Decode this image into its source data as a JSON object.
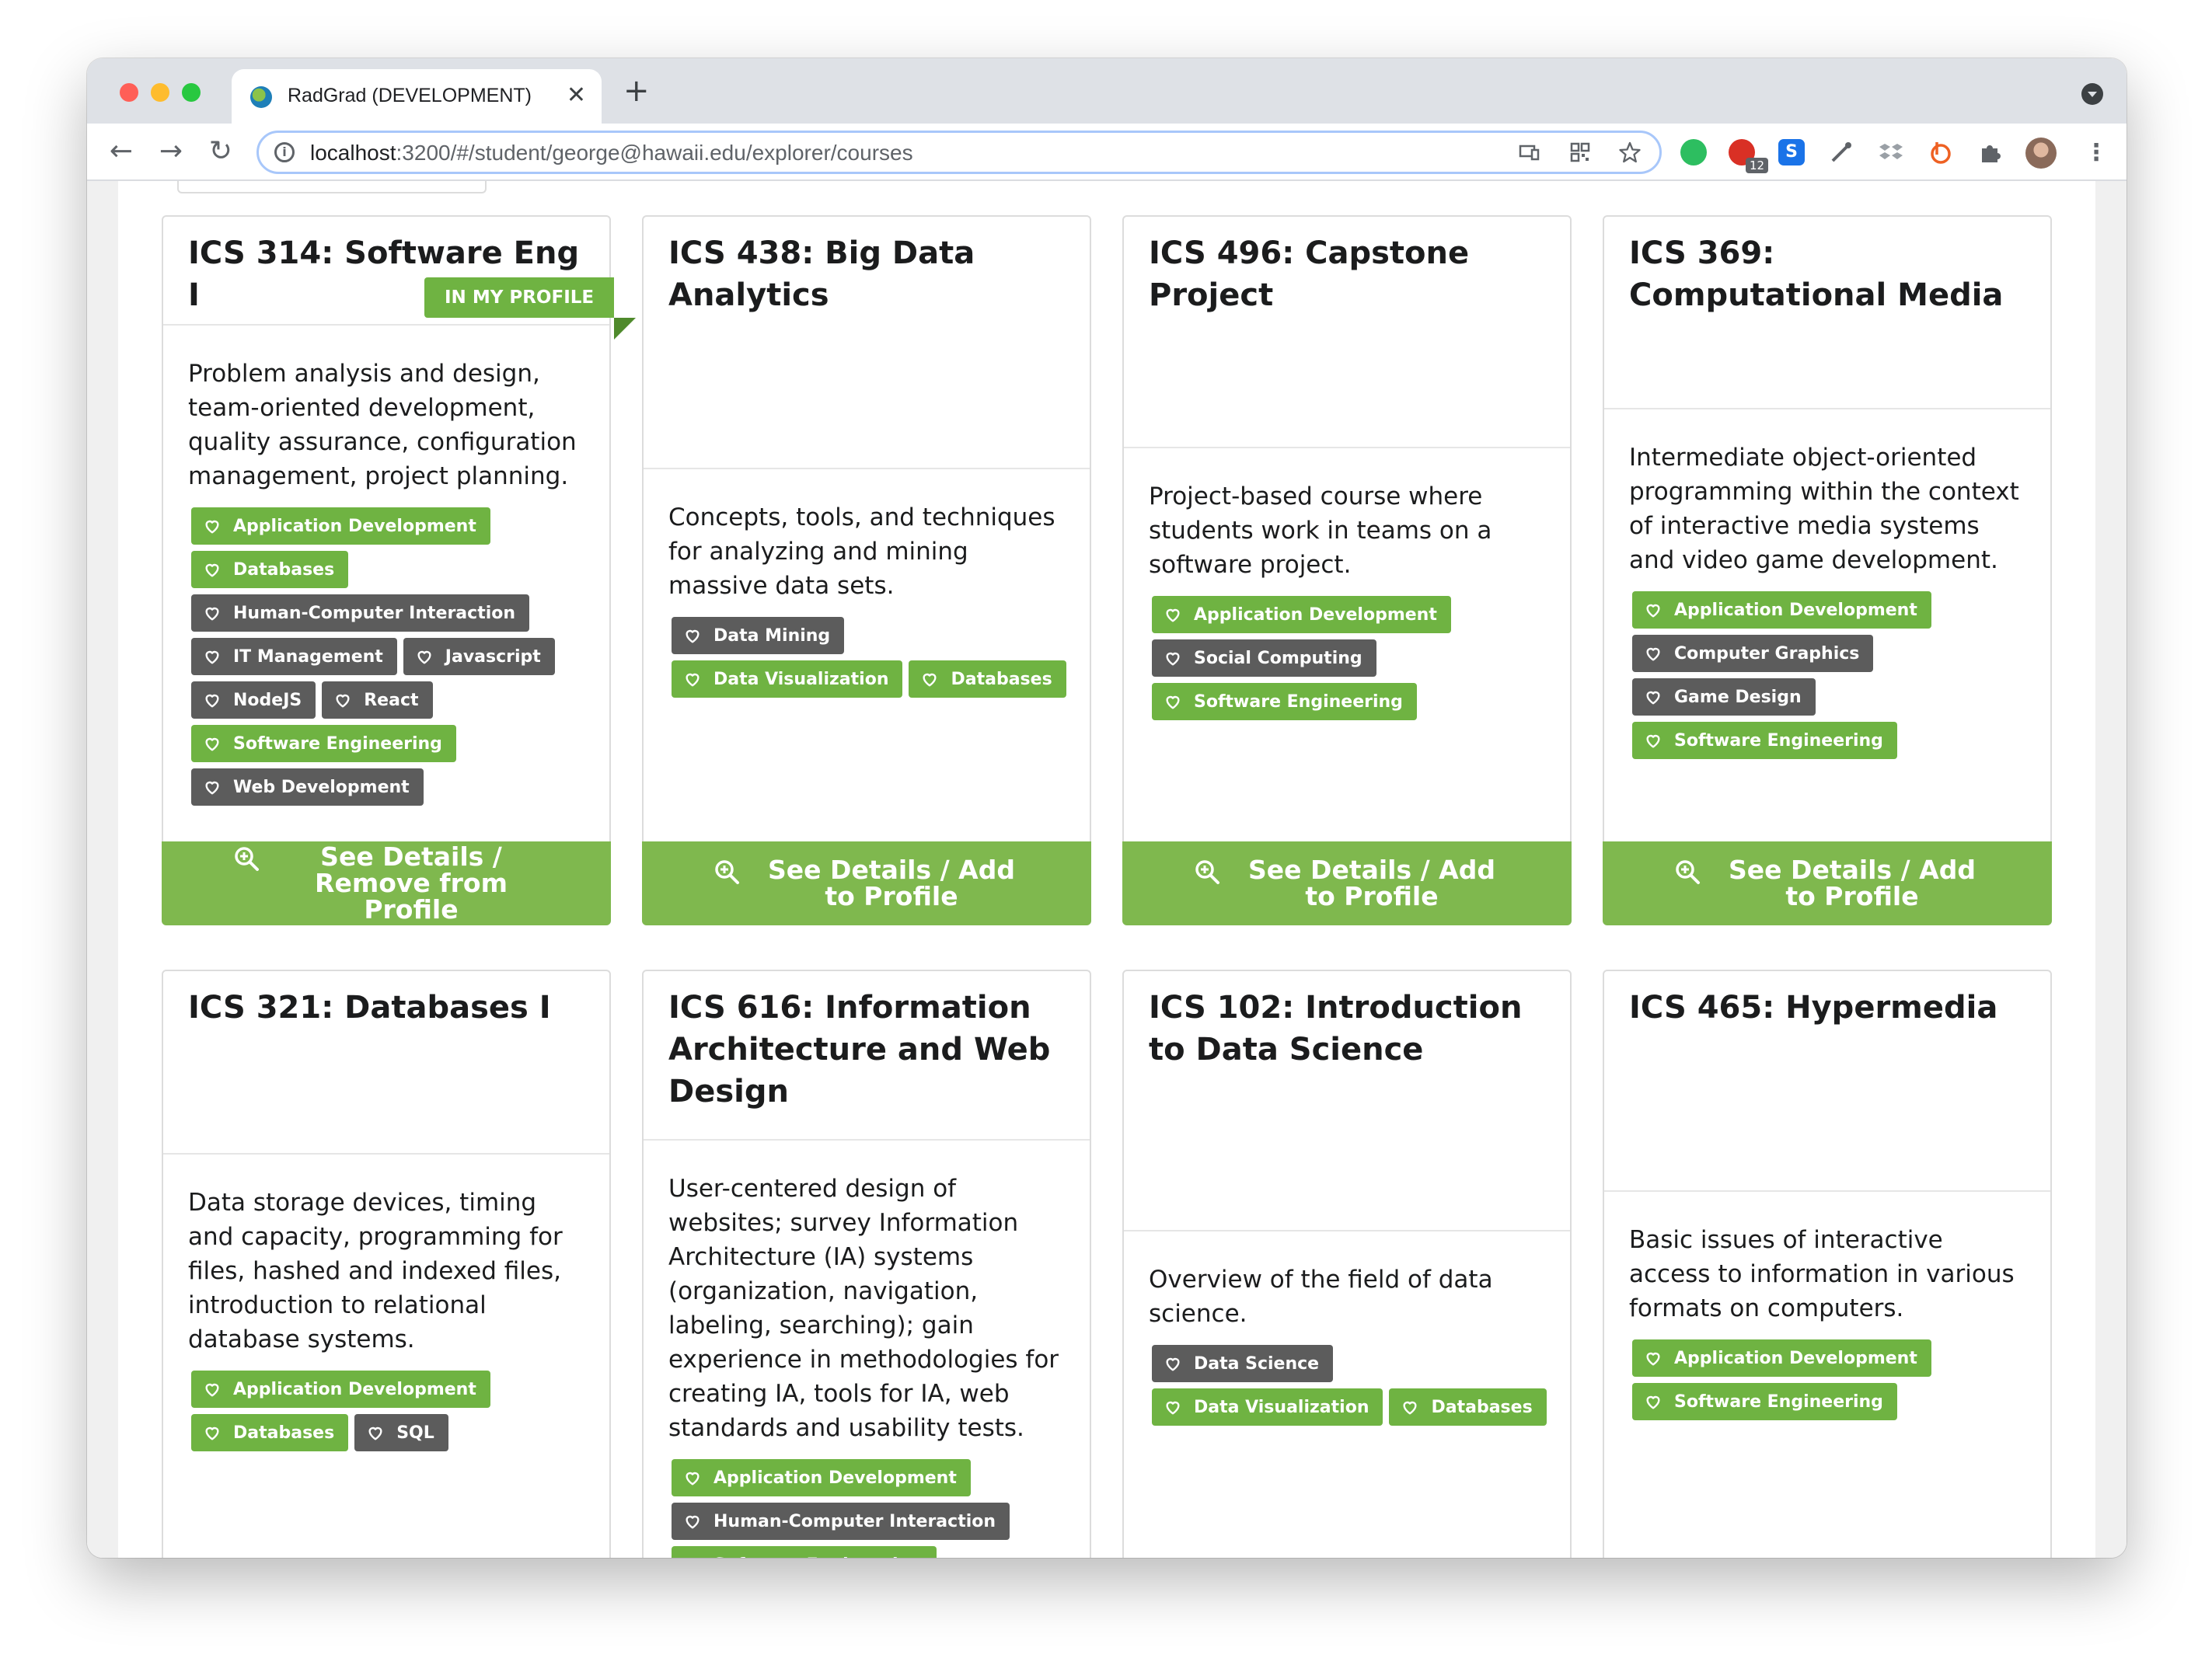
{
  "browser": {
    "tab_title": "RadGrad (DEVELOPMENT)",
    "tab_close": "✕",
    "new_tab": "+",
    "url_host": "localhost",
    "url_rest": ":3200/#/student/george@hawaii.edu/explorer/courses",
    "extension_badge": "12",
    "nav": {
      "back": "←",
      "forward": "→",
      "reload": "↻"
    }
  },
  "colors": {
    "tag_green": "#6fb342",
    "tag_gray": "#5c5c5c",
    "button_green": "#7fb84e"
  },
  "ribbon_label": "IN MY PROFILE",
  "courses": [
    {
      "title": "ICS 314: Software Eng I",
      "in_profile": true,
      "description": "Problem analysis and design, team-oriented development, quality assurance, configuration management, project planning.",
      "tags": [
        {
          "label": "Application Development",
          "color": "green"
        },
        {
          "label": "Databases",
          "color": "green"
        },
        {
          "label": "Human-Computer Interaction",
          "color": "gray"
        },
        {
          "label": "IT Management",
          "color": "gray"
        },
        {
          "label": "Javascript",
          "color": "gray"
        },
        {
          "label": "NodeJS",
          "color": "gray"
        },
        {
          "label": "React",
          "color": "gray"
        },
        {
          "label": "Software Engineering",
          "color": "green"
        },
        {
          "label": "Web Development",
          "color": "gray"
        }
      ],
      "button": "See Details / Remove from Profile"
    },
    {
      "title": "ICS 438: Big Data Analytics",
      "in_profile": false,
      "description": "Concepts, tools, and techniques for analyzing and mining massive data sets.",
      "tags": [
        {
          "label": "Data Mining",
          "color": "gray"
        },
        {
          "label": "Data Visualization",
          "color": "green"
        },
        {
          "label": "Databases",
          "color": "green"
        }
      ],
      "button": "See Details / Add to Profile"
    },
    {
      "title": "ICS 496: Capstone Project",
      "in_profile": false,
      "description": "Project-based course where students work in teams on a software project.",
      "tags": [
        {
          "label": "Application Development",
          "color": "green"
        },
        {
          "label": "Social Computing",
          "color": "gray"
        },
        {
          "label": "Software Engineering",
          "color": "green"
        }
      ],
      "button": "See Details / Add to Profile"
    },
    {
      "title": "ICS 369: Computational Media",
      "in_profile": false,
      "description": "Intermediate object-oriented programming within the context of interactive media systems and video game development.",
      "tags": [
        {
          "label": "Application Development",
          "color": "green"
        },
        {
          "label": "Computer Graphics",
          "color": "gray"
        },
        {
          "label": "Game Design",
          "color": "gray"
        },
        {
          "label": "Software Engineering",
          "color": "green"
        }
      ],
      "button": "See Details / Add to Profile"
    },
    {
      "title": "ICS 321: Databases I",
      "in_profile": false,
      "description": "Data storage devices, timing and capacity, programming for files, hashed and indexed files, introduction to relational database systems.",
      "tags": [
        {
          "label": "Application Development",
          "color": "green"
        },
        {
          "label": "Databases",
          "color": "green"
        },
        {
          "label": "SQL",
          "color": "gray"
        }
      ],
      "button": ""
    },
    {
      "title": "ICS 616: Information Architecture and Web Design",
      "in_profile": false,
      "description": "User-centered design of websites; survey Information Architecture (IA) systems (organization, navigation, labeling, searching); gain experience in methodologies for creating IA, tools for IA, web standards and usability tests.",
      "tags": [
        {
          "label": "Application Development",
          "color": "green"
        },
        {
          "label": "Human-Computer Interaction",
          "color": "gray"
        },
        {
          "label": "Software Engineering",
          "color": "green"
        }
      ],
      "button": ""
    },
    {
      "title": "ICS 102: Introduction to Data Science",
      "in_profile": false,
      "description": "Overview of the field of data science.",
      "tags": [
        {
          "label": "Data Science",
          "color": "gray"
        },
        {
          "label": "Data Visualization",
          "color": "green"
        },
        {
          "label": "Databases",
          "color": "green"
        }
      ],
      "button": ""
    },
    {
      "title": "ICS 465: Hypermedia",
      "in_profile": false,
      "description": "Basic issues of interactive access to information in various formats on computers.",
      "tags": [
        {
          "label": "Application Development",
          "color": "green"
        },
        {
          "label": "Software Engineering",
          "color": "green"
        }
      ],
      "button": ""
    }
  ]
}
